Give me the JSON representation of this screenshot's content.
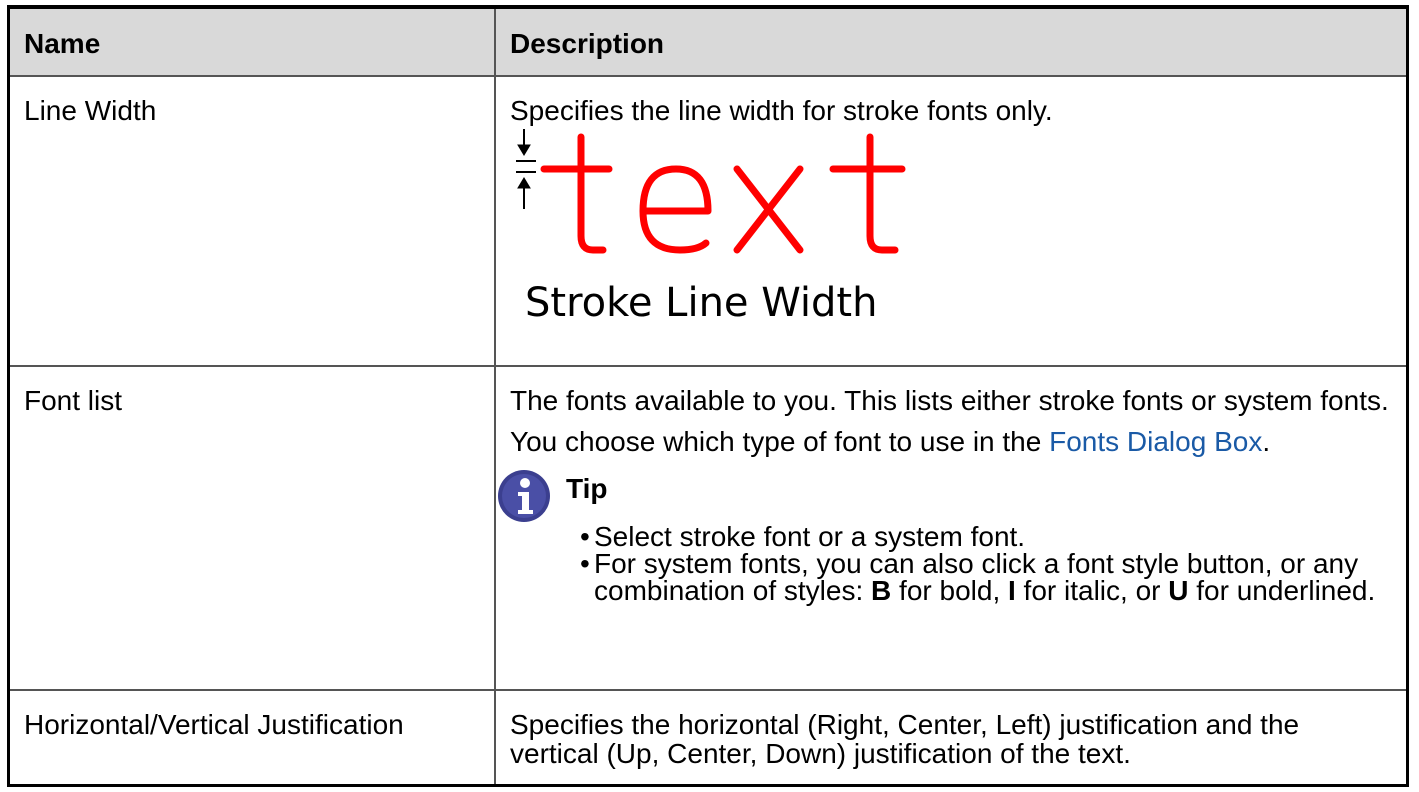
{
  "table": {
    "headers": [
      "Name",
      "Description"
    ],
    "rows": [
      {
        "name": "Line Width",
        "description": "Specifies the line width for stroke fonts only.",
        "figure": {
          "sample_text": "text",
          "caption": "Stroke Line Width",
          "sample_color": "#ff0000"
        }
      },
      {
        "name": "Font list",
        "description": "The fonts available to you. This lists either stroke fonts or system fonts.",
        "choose_prefix": "You choose which type of font to use in the ",
        "choose_link": "Fonts Dialog Box",
        "choose_suffix": ".",
        "tip": {
          "title": "Tip",
          "icon": "info-icon",
          "item1": "Select stroke font or a system font.",
          "item2_part1": "For system fonts, you can also click a font style button, or any combination of styles: ",
          "item2_b": "B",
          "item2_part2": " for bold, ",
          "item2_i": "I",
          "item2_part3": " for italic, or ",
          "item2_u": "U",
          "item2_part4": " for underlined."
        }
      },
      {
        "name": "Horizontal/Vertical Justification",
        "description": "Specifies the horizontal (Right, Center, Left) justification and the vertical (Up, Center, Down) justification of the text."
      }
    ]
  },
  "colors": {
    "header_bg": "#d9d9d9",
    "link": "#1a5aa6",
    "info_icon": "#3b3f8f"
  }
}
